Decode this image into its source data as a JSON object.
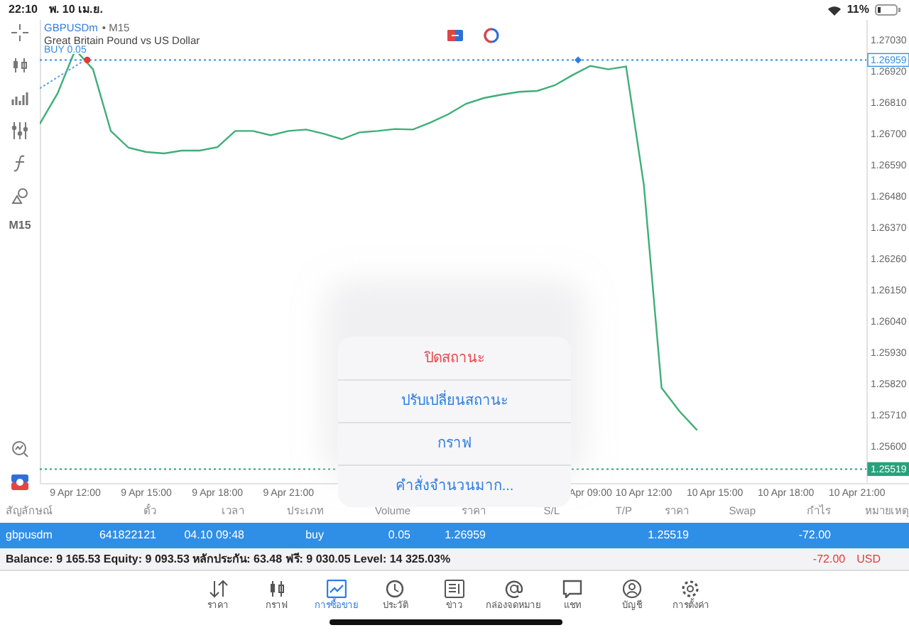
{
  "status_bar": {
    "time": "22:10",
    "date": "พ. 10 เม.ย.",
    "battery": "11%"
  },
  "toolbar": {
    "timeframe": "M15"
  },
  "chart": {
    "symbol": "GBPUSDm",
    "timeframe": "• M15",
    "description": "Great Britain Pound vs US Dollar",
    "chart_data": {
      "type": "line",
      "categories": [
        null,
        null,
        "9 Apr 12:00",
        null,
        null,
        null,
        "9 Apr 15:00",
        null,
        null,
        null,
        "9 Apr 18:00",
        null,
        null,
        null,
        "9 Apr 21:00",
        null,
        null,
        null,
        null,
        null,
        null,
        null,
        null,
        null,
        null,
        null,
        null,
        null,
        null,
        null,
        null,
        "Apr 09:00",
        null,
        null,
        "10 Apr 12:00",
        null,
        null,
        null,
        "10 Apr 15:00",
        null,
        null,
        null,
        "10 Apr 18:00",
        null,
        null,
        null,
        "10 Apr 21:00"
      ],
      "series": [
        {
          "color": "#3fae79",
          "values": [
            1.26734,
            1.26841,
            1.26995,
            1.26926,
            1.26709,
            1.2665,
            1.26635,
            1.2663,
            1.2664,
            1.2664,
            1.26652,
            1.26709,
            1.26709,
            1.26694,
            1.26709,
            1.26714,
            1.26699,
            1.2668,
            1.26704,
            1.26709,
            1.26716,
            1.26714,
            1.26739,
            1.26768,
            1.26805,
            1.26825,
            1.26837,
            1.26847,
            1.2685,
            1.2687,
            1.26906,
            1.26938,
            1.26926,
            1.26936,
            1.2652,
            1.25805,
            1.25723,
            1.25656,
            null,
            null,
            null,
            null,
            null,
            null,
            null,
            null,
            null
          ]
        }
      ],
      "ylim": [
        1.2547,
        1.271
      ],
      "yticks": [
        {
          "value": 1.2703,
          "label": "1.27030"
        },
        {
          "value": 1.2692,
          "label": "1.26920"
        },
        {
          "value": 1.2681,
          "label": "1.26810"
        },
        {
          "value": 1.267,
          "label": "1.26700"
        },
        {
          "value": 1.2659,
          "label": "1.26590"
        },
        {
          "value": 1.2648,
          "label": "1.26480"
        },
        {
          "value": 1.2637,
          "label": "1.26370"
        },
        {
          "value": 1.2626,
          "label": "1.26260"
        },
        {
          "value": 1.2615,
          "label": "1.26150"
        },
        {
          "value": 1.2604,
          "label": "1.26040"
        },
        {
          "value": 1.2593,
          "label": "1.25930"
        },
        {
          "value": 1.2582,
          "label": "1.25820"
        },
        {
          "value": 1.2571,
          "label": "1.25710"
        },
        {
          "value": 1.256,
          "label": "1.25600"
        }
      ],
      "ref_lines": [
        {
          "axis": "y",
          "value": 1.26959,
          "label": "BUY 0.05",
          "color": "#2f8ee6"
        },
        {
          "axis": "y",
          "value": 1.25519,
          "color": "#26a17b"
        }
      ]
    },
    "price_tags": [
      {
        "label": "1.26959",
        "filled": false
      },
      {
        "label": "1.25519",
        "filled": true
      }
    ]
  },
  "context_menu": [
    {
      "label": "ปิดสถานะ",
      "kind": "destructive"
    },
    {
      "label": "ปรับเปลี่ยนสถานะ",
      "kind": "action"
    },
    {
      "label": "กราฟ",
      "kind": "action"
    },
    {
      "label": "คำสั่งจำนวนมาก...",
      "kind": "action"
    }
  ],
  "positions": {
    "columns": [
      "สัญลักษณ์",
      "ตั๋ว",
      "เวลา",
      "ประเภท",
      "Volume",
      "ราคา",
      "S/L",
      "T/P",
      "ราคา",
      "Swap",
      "กำไร",
      "หมายเหตุ"
    ],
    "rows": [
      {
        "selected": true,
        "cells": [
          "gbpusdm",
          "641822121",
          "04.10 09:48",
          "buy",
          "0.05",
          "1.26959",
          null,
          null,
          "1.25519",
          null,
          "-72.00",
          null
        ]
      }
    ]
  },
  "summary": {
    "text": "Balance: 9 165.53 Equity: 9 093.53 หลักประกัน: 63.48 ฟรี: 9 030.05 Level: 14 325.03%",
    "profit": "-72.00",
    "currency": "USD"
  },
  "tabs": [
    {
      "label": "ราคา",
      "kind": "quotes",
      "selected": false
    },
    {
      "label": "กราฟ",
      "kind": "chart",
      "selected": false
    },
    {
      "label": "การซื้อขาย",
      "kind": "trade",
      "selected": true
    },
    {
      "label": "ประวัติ",
      "kind": "history",
      "selected": false
    },
    {
      "label": "ข่าว",
      "kind": "news",
      "selected": false
    },
    {
      "label": "กล่องจดหมาย",
      "kind": "mail",
      "selected": false
    },
    {
      "label": "แชท",
      "kind": "chat",
      "selected": false
    },
    {
      "label": "บัญชี",
      "kind": "account",
      "selected": false
    },
    {
      "label": "การตั้งค่า",
      "kind": "settings",
      "selected": false
    }
  ]
}
